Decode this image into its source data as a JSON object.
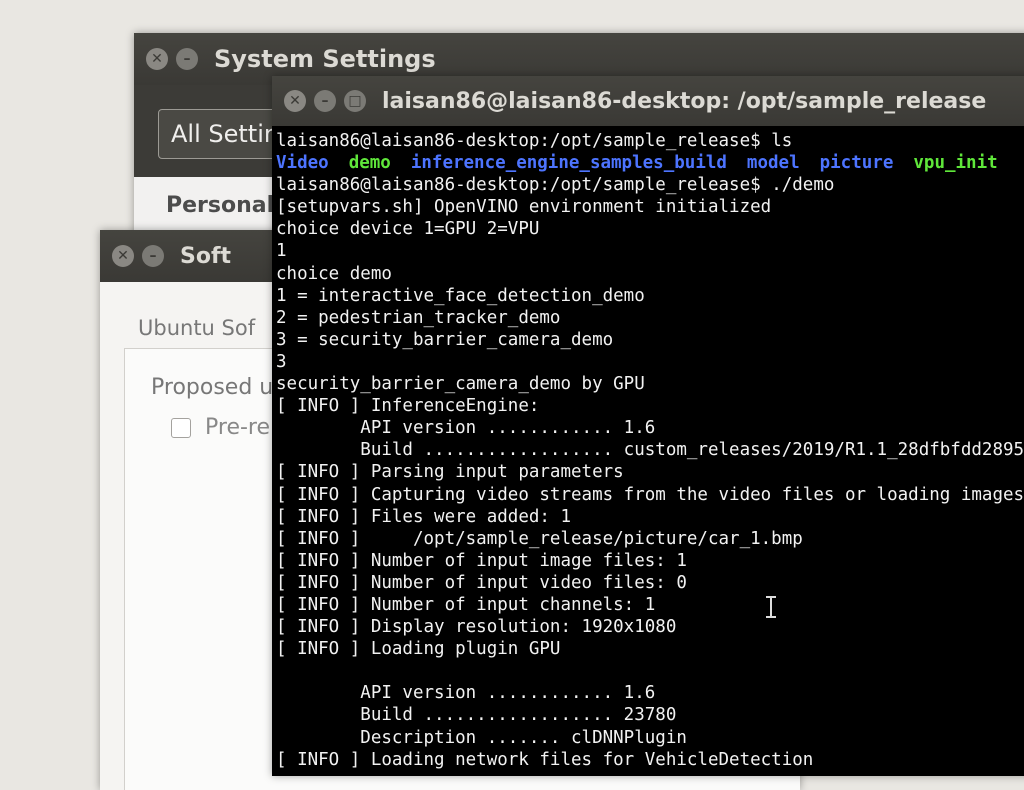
{
  "system_settings": {
    "title": "System Settings",
    "all_settings_label": "All Settin",
    "section_label": "Personal"
  },
  "software_window": {
    "title": "Soft",
    "tab_label": "Ubuntu Sof",
    "proposed_label": "Proposed u",
    "prerelease_label": "Pre-re"
  },
  "terminal": {
    "title": "laisan86@laisan86-desktop: /opt/sample_release",
    "prompt": "laisan86@laisan86-desktop:/opt/sample_release$ ",
    "cmd1": "ls",
    "ls_output": [
      {
        "text": "Video",
        "kind": "dir"
      },
      {
        "text": "demo",
        "kind": "exe"
      },
      {
        "text": "inference_engine_samples_build",
        "kind": "dir"
      },
      {
        "text": "model",
        "kind": "dir"
      },
      {
        "text": "picture",
        "kind": "dir"
      },
      {
        "text": "vpu_init",
        "kind": "exe"
      }
    ],
    "cmd2": "./demo",
    "lines": [
      "[setupvars.sh] OpenVINO environment initialized",
      "choice device 1=GPU 2=VPU",
      "1",
      "choice demo",
      "1 = interactive_face_detection_demo",
      "2 = pedestrian_tracker_demo",
      "3 = security_barrier_camera_demo",
      "3",
      "security_barrier_camera_demo by GPU",
      "[ INFO ] InferenceEngine:",
      "        API version ............ 1.6",
      "        Build .................. custom_releases/2019/R1.1_28dfbfdd2895",
      "[ INFO ] Parsing input parameters",
      "[ INFO ] Capturing video streams from the video files or loading images",
      "[ INFO ] Files were added: 1",
      "[ INFO ]     /opt/sample_release/picture/car_1.bmp",
      "[ INFO ] Number of input image files: 1",
      "[ INFO ] Number of input video files: 0",
      "[ INFO ] Number of input channels: 1",
      "[ INFO ] Display resolution: 1920x1080",
      "[ INFO ] Loading plugin GPU",
      "",
      "        API version ............ 1.6",
      "        Build .................. 23780",
      "        Description ....... clDNNPlugin",
      "[ INFO ] Loading network files for VehicleDetection"
    ]
  },
  "icons": {
    "close": "✕",
    "minimize": "–",
    "maximize": "□"
  }
}
